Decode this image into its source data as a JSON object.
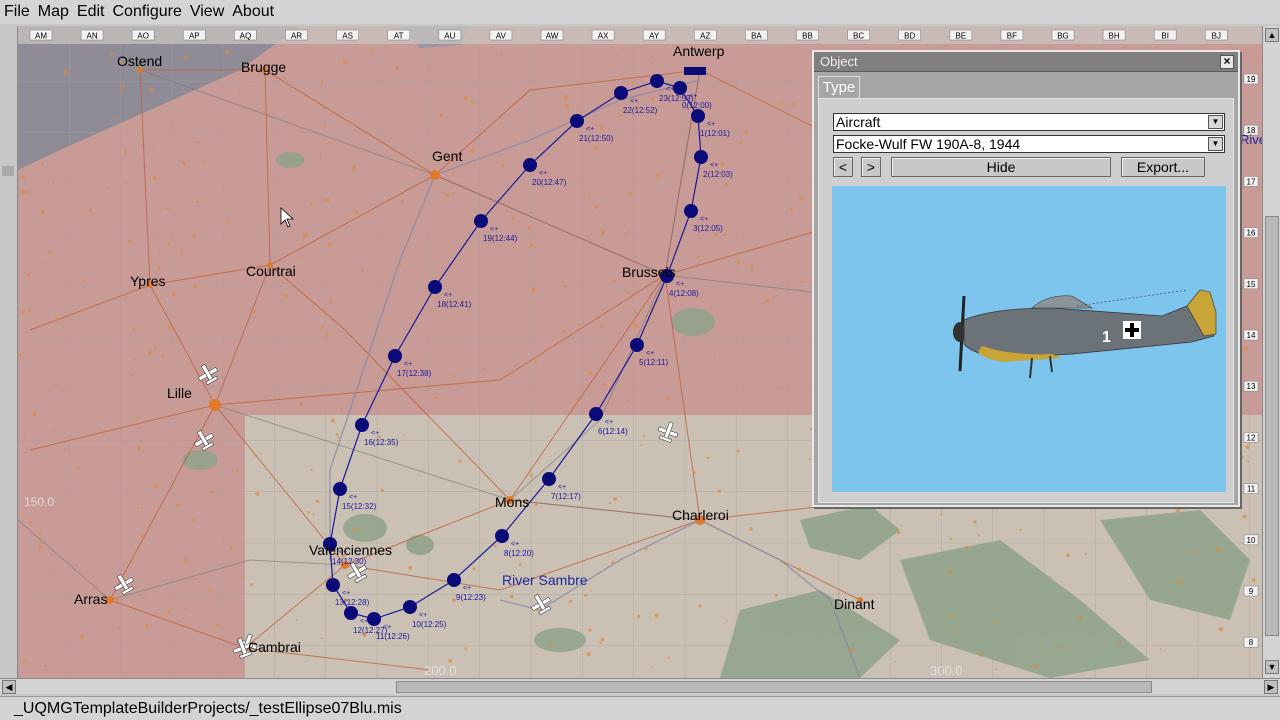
{
  "menubar": {
    "items": [
      "File",
      "Map",
      "Edit",
      "Configure",
      "View",
      "About"
    ]
  },
  "map": {
    "column_labels": [
      "AM",
      "AN",
      "AO",
      "AP",
      "AQ",
      "AR",
      "AS",
      "AT",
      "AU",
      "AV",
      "AW",
      "AX",
      "AY",
      "AZ",
      "BA",
      "BB",
      "BC",
      "BD",
      "BE",
      "BF",
      "BG",
      "BH",
      "BI",
      "BJ"
    ],
    "row_labels": [
      "19",
      "18",
      "17",
      "16",
      "15",
      "14",
      "13",
      "12",
      "11",
      "10",
      "9",
      "8"
    ],
    "cities": [
      "Ostend",
      "Brugge",
      "Gent",
      "Antwerp",
      "Ypres",
      "Courtrai",
      "Brussels",
      "Lille",
      "Mons",
      "Charleroi",
      "Valenciennes",
      "Arras",
      "Cambrai",
      "Dinant"
    ],
    "river_label": "River Sambre",
    "partial_label": "Rive",
    "faded_labels": [
      "150.0",
      "200.0",
      "300.0"
    ],
    "waypoints": [
      {
        "num": "1",
        "time": "12:01"
      },
      {
        "num": "2",
        "time": "12:03"
      },
      {
        "num": "3",
        "time": "12:05"
      },
      {
        "num": "4",
        "time": "12:08"
      },
      {
        "num": "5",
        "time": "12:11"
      },
      {
        "num": "6",
        "time": "12:14"
      },
      {
        "num": "7",
        "time": "12:17"
      },
      {
        "num": "8",
        "time": "12:20"
      },
      {
        "num": "9",
        "time": "12:23"
      },
      {
        "num": "10",
        "time": "12:25"
      },
      {
        "num": "11",
        "time": "12:26"
      },
      {
        "num": "12",
        "time": "12:27"
      },
      {
        "num": "13",
        "time": "12:28"
      },
      {
        "num": "14",
        "time": "12:30"
      },
      {
        "num": "15",
        "time": "12:32"
      },
      {
        "num": "16",
        "time": "12:35"
      },
      {
        "num": "17",
        "time": "12:38"
      },
      {
        "num": "18",
        "time": "12:41"
      },
      {
        "num": "19",
        "time": "12:44"
      },
      {
        "num": "20",
        "time": "12:47"
      },
      {
        "num": "21",
        "time": "12:50"
      },
      {
        "num": "22",
        "time": "12:52"
      },
      {
        "num": "23",
        "time": "12:53"
      },
      {
        "num": "0",
        "time": "12:00"
      }
    ],
    "waypoint_prefix": "<+",
    "colors": {
      "red_zone": "#c79a96",
      "neutral_zone": "#cbc0b4",
      "sea": "#8f8c97",
      "route": "#1a1a99",
      "waypoint": "#0a0a78"
    }
  },
  "object_panel": {
    "title": "Object",
    "tab_label": "Type",
    "category_value": "Aircraft",
    "aircraft_value": "Focke-Wulf FW 190A-8, 1944",
    "prev_label": "<",
    "next_label": ">",
    "hide_label": "Hide",
    "export_label": "Export...",
    "close_label": "×",
    "preview_background": "#7ec5ee",
    "aircraft_number": "1"
  },
  "statusbar": {
    "path": "_UQMGTemplateBuilderProjects/_testEllipse07Blu.mis"
  }
}
